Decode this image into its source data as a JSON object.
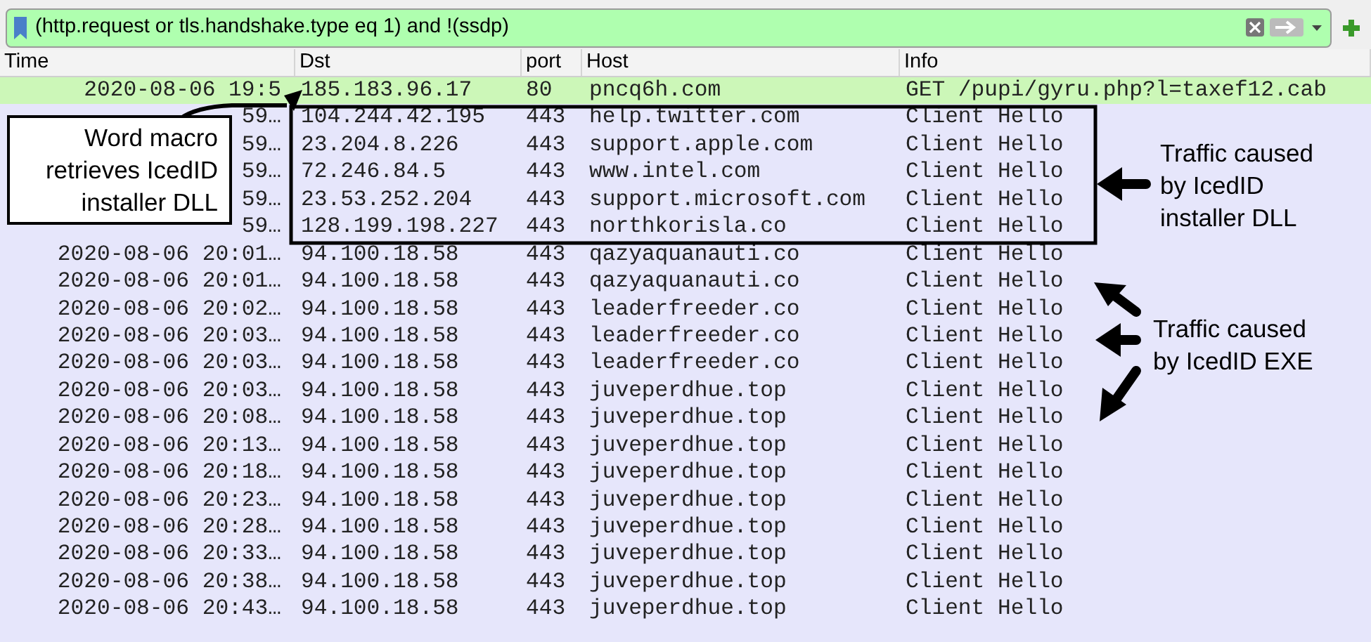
{
  "filter": {
    "value": "(http.request or tls.handshake.type eq 1) and !(ssdp)"
  },
  "table": {
    "columns": [
      "Time",
      "Dst",
      "port",
      "Host",
      "Info"
    ],
    "rows": [
      {
        "time": "2020-08-06 19:5",
        "dst": "185.183.96.17",
        "port": "80",
        "host": "pncq6h.com",
        "info": "GET /pupi/gyru.php?l=taxef12.cab",
        "color": "#ccf7b8"
      },
      {
        "time": "59…",
        "dst": "104.244.42.195",
        "port": "443",
        "host": "help.twitter.com",
        "info": "Client Hello",
        "color": "#e6e6fb"
      },
      {
        "time": "59…",
        "dst": "23.204.8.226",
        "port": "443",
        "host": "support.apple.com",
        "info": "Client Hello",
        "color": "#e6e6fb"
      },
      {
        "time": "59…",
        "dst": "72.246.84.5",
        "port": "443",
        "host": "www.intel.com",
        "info": "Client Hello",
        "color": "#e6e6fb"
      },
      {
        "time": "59…",
        "dst": "23.53.252.204",
        "port": "443",
        "host": "support.microsoft.com",
        "info": "Client Hello",
        "color": "#e6e6fb"
      },
      {
        "time": "59…",
        "dst": "128.199.198.227",
        "port": "443",
        "host": "northkorisla.co",
        "info": "Client Hello",
        "color": "#e6e6fb"
      },
      {
        "time": "2020-08-06 20:01…",
        "dst": "94.100.18.58",
        "port": "443",
        "host": "qazyaquanauti.co",
        "info": "Client Hello",
        "color": "#e6e6fb"
      },
      {
        "time": "2020-08-06 20:01…",
        "dst": "94.100.18.58",
        "port": "443",
        "host": "qazyaquanauti.co",
        "info": "Client Hello",
        "color": "#e6e6fb"
      },
      {
        "time": "2020-08-06 20:02…",
        "dst": "94.100.18.58",
        "port": "443",
        "host": "leaderfreeder.co",
        "info": "Client Hello",
        "color": "#e6e6fb"
      },
      {
        "time": "2020-08-06 20:03…",
        "dst": "94.100.18.58",
        "port": "443",
        "host": "leaderfreeder.co",
        "info": "Client Hello",
        "color": "#e6e6fb"
      },
      {
        "time": "2020-08-06 20:03…",
        "dst": "94.100.18.58",
        "port": "443",
        "host": "leaderfreeder.co",
        "info": "Client Hello",
        "color": "#e6e6fb"
      },
      {
        "time": "2020-08-06 20:03…",
        "dst": "94.100.18.58",
        "port": "443",
        "host": "juveperdhue.top",
        "info": "Client Hello",
        "color": "#e6e6fb"
      },
      {
        "time": "2020-08-06 20:08…",
        "dst": "94.100.18.58",
        "port": "443",
        "host": "juveperdhue.top",
        "info": "Client Hello",
        "color": "#e6e6fb"
      },
      {
        "time": "2020-08-06 20:13…",
        "dst": "94.100.18.58",
        "port": "443",
        "host": "juveperdhue.top",
        "info": "Client Hello",
        "color": "#e6e6fb"
      },
      {
        "time": "2020-08-06 20:18…",
        "dst": "94.100.18.58",
        "port": "443",
        "host": "juveperdhue.top",
        "info": "Client Hello",
        "color": "#e6e6fb"
      },
      {
        "time": "2020-08-06 20:23…",
        "dst": "94.100.18.58",
        "port": "443",
        "host": "juveperdhue.top",
        "info": "Client Hello",
        "color": "#e6e6fb"
      },
      {
        "time": "2020-08-06 20:28…",
        "dst": "94.100.18.58",
        "port": "443",
        "host": "juveperdhue.top",
        "info": "Client Hello",
        "color": "#e6e6fb"
      },
      {
        "time": "2020-08-06 20:33…",
        "dst": "94.100.18.58",
        "port": "443",
        "host": "juveperdhue.top",
        "info": "Client Hello",
        "color": "#e6e6fb"
      },
      {
        "time": "2020-08-06 20:38…",
        "dst": "94.100.18.58",
        "port": "443",
        "host": "juveperdhue.top",
        "info": "Client Hello",
        "color": "#e6e6fb"
      },
      {
        "time": "2020-08-06 20:43…",
        "dst": "94.100.18.58",
        "port": "443",
        "host": "juveperdhue.top",
        "info": "Client Hello",
        "color": "#e6e6fb"
      }
    ]
  },
  "annotations": [
    {
      "kind": "callout",
      "text": "Word macro retrieves IcedID installer DLL"
    },
    {
      "kind": "note",
      "text": "Traffic caused by IcedID installer DLL"
    },
    {
      "kind": "note",
      "text": "Traffic caused by IcedID EXE"
    }
  ]
}
